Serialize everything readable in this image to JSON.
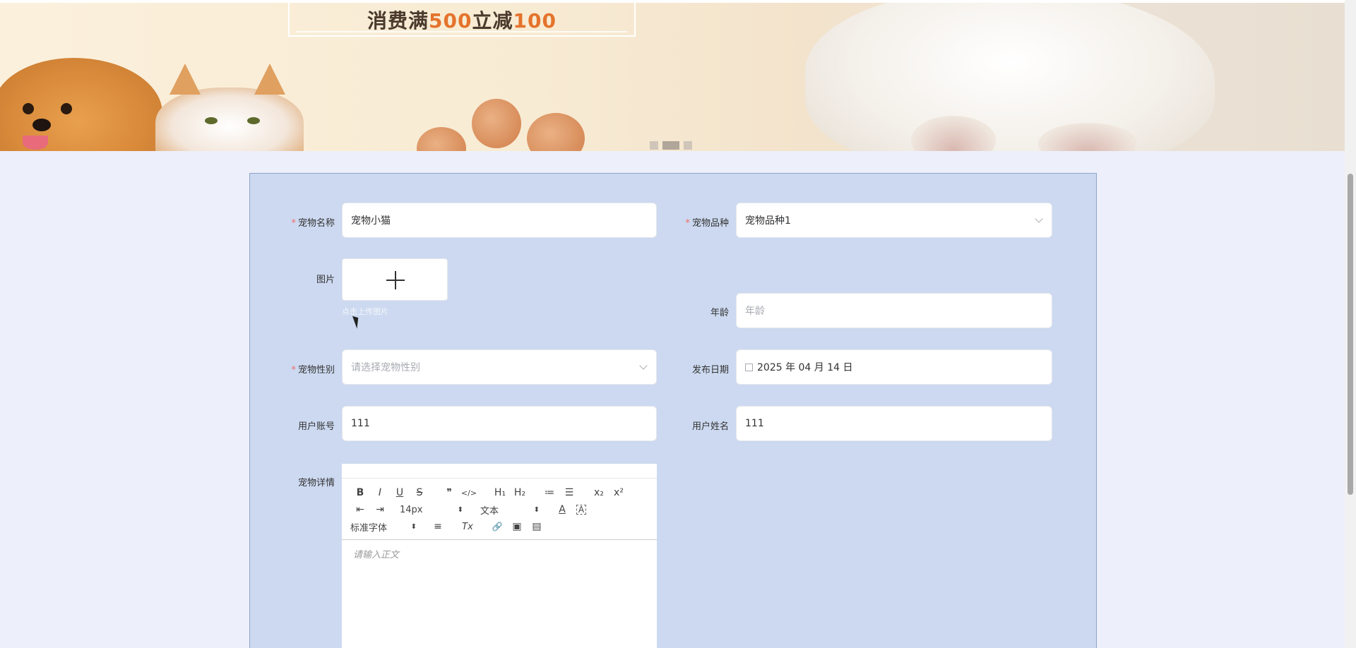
{
  "banner": {
    "promo_prefix": "消费满",
    "promo_amount": "500",
    "promo_mid": "立减",
    "promo_discount": "100",
    "slides": 3,
    "active_slide": 2
  },
  "form": {
    "pet_name": {
      "label": "宠物名称",
      "value": "宠物小猫",
      "required": true
    },
    "pet_breed": {
      "label": "宠物品种",
      "value": "宠物品种1",
      "required": true
    },
    "image": {
      "label": "图片",
      "tip": "点击上传图片"
    },
    "age": {
      "label": "年龄",
      "placeholder": "年龄"
    },
    "pet_gender": {
      "label": "宠物性别",
      "placeholder": "请选择宠物性别",
      "required": true
    },
    "publish_date": {
      "label": "发布日期",
      "value": "2025 年 04 月 14 日"
    },
    "user_account": {
      "label": "用户账号",
      "value": "111"
    },
    "user_name": {
      "label": "用户姓名",
      "value": "111"
    },
    "pet_details": {
      "label": "宠物详情",
      "placeholder": "请输入正文"
    }
  },
  "editor_toolbar": {
    "bold": "B",
    "italic": "I",
    "underline": "U",
    "strike": "S",
    "quote": "❞",
    "code": "</>",
    "h1": "H₁",
    "h2": "H₂",
    "ordered_list": "≔",
    "bullet_list": "☰",
    "subscript": "x₂",
    "superscript": "x²",
    "indent_out": "⇤",
    "indent_in": "⇥",
    "font_size": "14px",
    "text_type": "文本",
    "font_color": "A",
    "bg_color": "A",
    "font_family": "标准字体",
    "align": "≡",
    "clear_format": "Tx",
    "link": "🔗",
    "image": "▣",
    "video": "▤"
  },
  "colors": {
    "page_bg": "#edf0fa",
    "panel_bg": "#ccd9f0",
    "required": "#f56c6c",
    "promo_highlight": "#e4732c"
  }
}
